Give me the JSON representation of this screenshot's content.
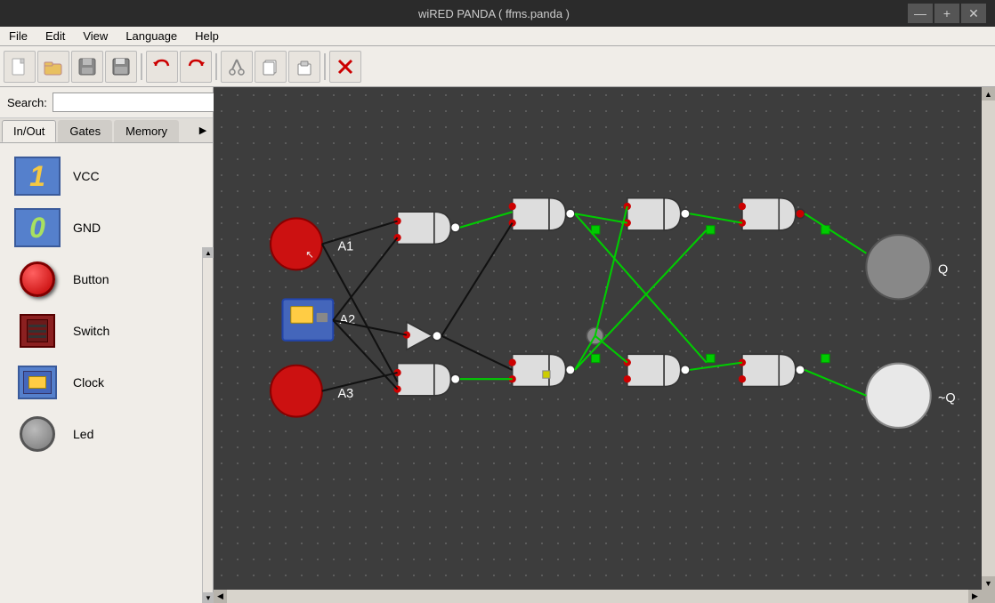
{
  "titlebar": {
    "title": "wiRED PANDA ( ffms.panda )",
    "minimize": "—",
    "maximize": "+",
    "close": "✕"
  },
  "menubar": {
    "items": [
      "File",
      "Edit",
      "View",
      "Language",
      "Help"
    ]
  },
  "toolbar": {
    "buttons": [
      {
        "name": "new",
        "icon": "📄"
      },
      {
        "name": "open",
        "icon": "📂"
      },
      {
        "name": "save-gray",
        "icon": "💾"
      },
      {
        "name": "save",
        "icon": "💾"
      },
      {
        "name": "undo",
        "icon": "↺"
      },
      {
        "name": "redo",
        "icon": "↻"
      },
      {
        "name": "cut",
        "icon": "✂"
      },
      {
        "name": "copy",
        "icon": "⧉"
      },
      {
        "name": "paste",
        "icon": "📋"
      },
      {
        "name": "delete",
        "icon": "✕"
      }
    ]
  },
  "search": {
    "label": "Search:",
    "placeholder": ""
  },
  "tabs": {
    "items": [
      "In/Out",
      "Gates",
      "Memory"
    ],
    "active": 0
  },
  "components": [
    {
      "name": "VCC",
      "type": "vcc"
    },
    {
      "name": "GND",
      "type": "gnd"
    },
    {
      "name": "Button",
      "type": "button"
    },
    {
      "name": "Switch",
      "type": "switch"
    },
    {
      "name": "Clock",
      "type": "clock"
    },
    {
      "name": "Led",
      "type": "led"
    }
  ],
  "circuit": {
    "labels": [
      "A1",
      "A2",
      "A3",
      "Q",
      "~Q"
    ],
    "node_q": "Q",
    "node_nq": "~Q"
  }
}
